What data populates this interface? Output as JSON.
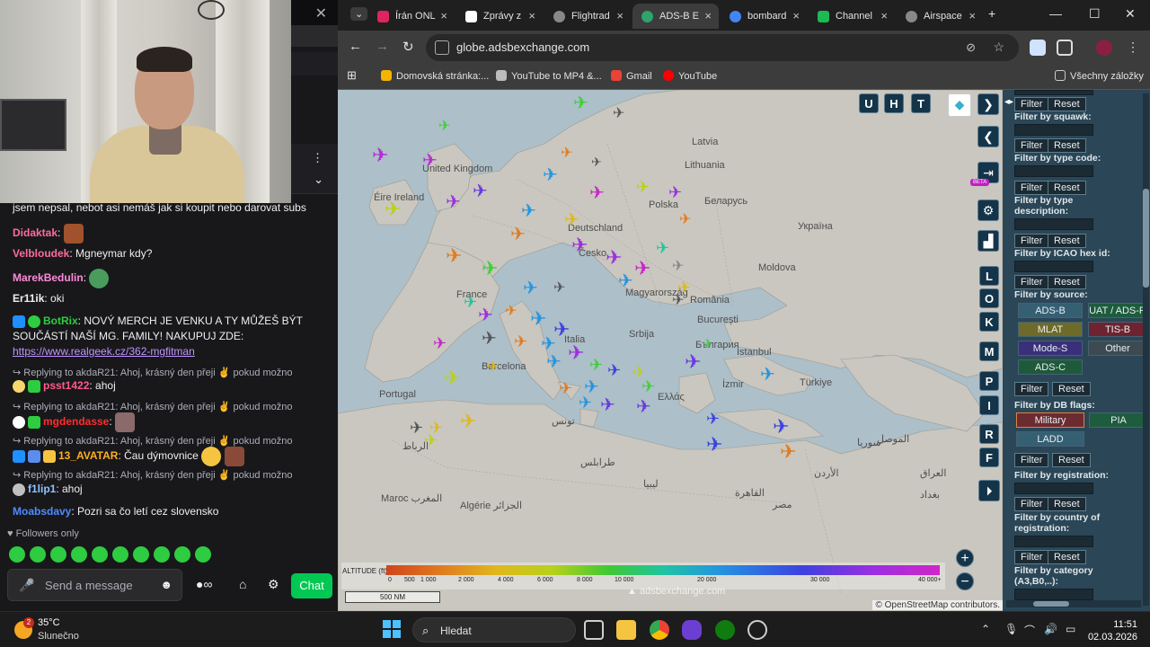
{
  "chat": {
    "messages": [
      {
        "user": "",
        "text": "jsem nepsal, nebot asi nemáš jak si koupit nebo darovat subs"
      },
      {
        "user": "Didaktak",
        "text": ":"
      },
      {
        "user": "Velbloudek",
        "text": ": Mgneymar kdy?"
      },
      {
        "user": "MarekBedulin",
        "text": ":"
      },
      {
        "user": "Er11ik",
        "text": ": oki"
      },
      {
        "user": "BotRix",
        "text": ": NOVÝ MERCH JE VENKU A TY MŮŽEŠ BÝT"
      },
      {
        "user": "",
        "text": "SOUČÁSTÍ NAŠÍ MG. FAMILY! NAKUPUJ ZDE:"
      },
      {
        "user": "",
        "text": "https://www.realgeek.cz/362-mgfitman"
      },
      {
        "user": "psst1422",
        "text": ": ahoj"
      },
      {
        "user": "mgdendasse",
        "text": ":"
      },
      {
        "user": "13_AVATAR",
        "text": ": Čau dýmovnice"
      },
      {
        "user": "f1lip1",
        "text": ": ahoj"
      },
      {
        "user": "Moabsdavy",
        "text": ": Pozri sa čo letí cez slovensko"
      }
    ],
    "reply_text": "Replying to akdaR21: Ahoj, krásný den přeji ✌ pokud možno",
    "followers_only": "Followers only",
    "input_placeholder": "Send a message",
    "chat_button": "Chat"
  },
  "browser": {
    "tabs": [
      {
        "label": "Írán ONL",
        "color": "#e0245e"
      },
      {
        "label": "Zprávy z",
        "color": "#ffffff"
      },
      {
        "label": "Flightrad",
        "color": "#cccccc"
      },
      {
        "label": "ADS-B E",
        "color": "#2ea36b"
      },
      {
        "label": "bombard",
        "color": "#4285f4"
      },
      {
        "label": "Channel",
        "color": "#1db954"
      },
      {
        "label": "Airspace",
        "color": "#cccccc"
      }
    ],
    "url": "globe.adsbexchange.com",
    "bookmarks": [
      "Domovská stránka:...",
      "YouTube to MP4 &...",
      "Gmail",
      "YouTube"
    ],
    "all_bookmarks": "Všechny záložky"
  },
  "map": {
    "countries": [
      {
        "name": "Latvia"
      },
      {
        "name": "Lithuania"
      },
      {
        "name": "Беларусь"
      },
      {
        "name": "United Kingdom"
      },
      {
        "name": "Éire Ireland"
      },
      {
        "name": "Polska"
      },
      {
        "name": "Україна"
      },
      {
        "name": "Deutschland"
      },
      {
        "name": "Česko"
      },
      {
        "name": "Moldova"
      },
      {
        "name": "Magyarország"
      },
      {
        "name": "France"
      },
      {
        "name": "România"
      },
      {
        "name": "Srbija"
      },
      {
        "name": "București"
      },
      {
        "name": "България"
      },
      {
        "name": "Italia"
      },
      {
        "name": "Portugal"
      },
      {
        "name": "Barcelona"
      },
      {
        "name": "İstanbul"
      },
      {
        "name": "Türkiye"
      },
      {
        "name": "Ελλάς"
      },
      {
        "name": "İzmir"
      },
      {
        "name": "Algérie الجزائر"
      },
      {
        "name": "تونس"
      },
      {
        "name": "ليبيا"
      },
      {
        "name": "مصر"
      },
      {
        "name": "الأردن"
      },
      {
        "name": "العراق"
      },
      {
        "name": "الرباط"
      },
      {
        "name": "Maroc المغرب"
      },
      {
        "name": "سوريا"
      },
      {
        "name": "الموصل"
      },
      {
        "name": "بغداد"
      },
      {
        "name": "القاهرة"
      },
      {
        "name": "طرابلس"
      }
    ],
    "toggle_buttons": [
      "U",
      "H",
      "T"
    ],
    "side_letters": [
      "L",
      "O",
      "K",
      "M",
      "P",
      "I",
      "R",
      "F"
    ],
    "beta": "BETA",
    "altitude_label": "ALTITUDE (ft)",
    "altitude_ticks": [
      "0",
      "500",
      "1 000",
      "2 000",
      "4 000",
      "6 000",
      "8 000",
      "10 000",
      "20 000",
      "30 000",
      "40 000+"
    ],
    "scale": "500 NM",
    "watermark": "adsbexchange.com",
    "attribution": "© OpenStreetMap contributors."
  },
  "filters": {
    "filter_label": "Filter",
    "reset_label": "Reset",
    "labels": [
      "Filter by squawk:",
      "Filter by type code:",
      "Filter by type",
      "description:",
      "Filter by ICAO hex id:",
      "Filter by source:",
      "Filter by DB flags:",
      "Filter by registration:",
      "Filter by country of",
      "registration:",
      "Filter by category",
      "(A3,B0,..):"
    ],
    "sources": [
      "ADS-B",
      "UAT / ADS-R",
      "MLAT",
      "TIS-B",
      "Mode-S",
      "Other",
      "ADS-C"
    ],
    "db_flags": [
      "Military",
      "PIA",
      "LADD"
    ]
  },
  "taskbar": {
    "weather_badge": "2",
    "temperature": "35°C",
    "weather_desc": "Slunečno",
    "search_placeholder": "Hledat",
    "time": "11:51",
    "date": "02.03.2026"
  }
}
